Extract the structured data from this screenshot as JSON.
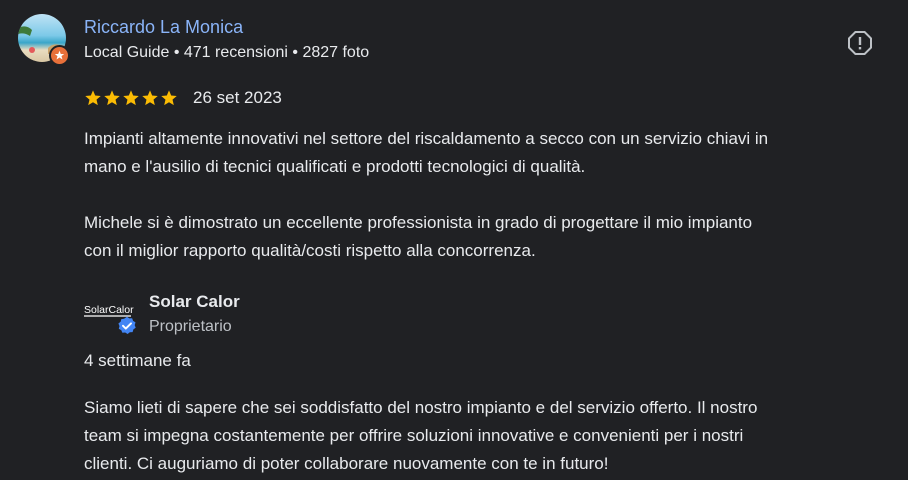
{
  "review": {
    "author": {
      "name": "Riccardo La Monica",
      "meta": "Local Guide • 471 recensioni • 2827 foto",
      "avatar_icon": "beach-avatar",
      "badge_icon": "local-guide-badge-icon"
    },
    "report_icon": "report-icon",
    "rating": {
      "stars": 5,
      "max": 5,
      "color": "#fbbc04"
    },
    "date": "26 set 2023",
    "text": "Impianti altamente innovativi nel settore del riscaldamento a secco con un servizio chiavi in\nmano e l'ausilio di tecnici qualificati e prodotti tecnologici di qualità.\n\nMichele si è dimostrato un eccellente professionista in grado di progettare il mio impianto\ncon il miglior rapporto qualità/costi rispetto alla concorrenza."
  },
  "owner_reply": {
    "name": "Solar Calor",
    "role": "Proprietario",
    "logo_text": "SolarCalor",
    "verified_icon": "verified-badge-icon",
    "date": "4 settimane fa",
    "text": "Siamo lieti di sapere che sei soddisfatto del nostro impianto e del servizio offerto. Il nostro\nteam si impegna costantemente per offrire soluzioni innovative e convenienti per i nostri\nclienti. Ci auguriamo di poter collaborare nuovamente con te in futuro!"
  },
  "colors": {
    "background": "#202124",
    "link": "#8ab4f8",
    "text": "#e8eaed",
    "verified": "#4285f4",
    "badge": "#e8703a"
  }
}
